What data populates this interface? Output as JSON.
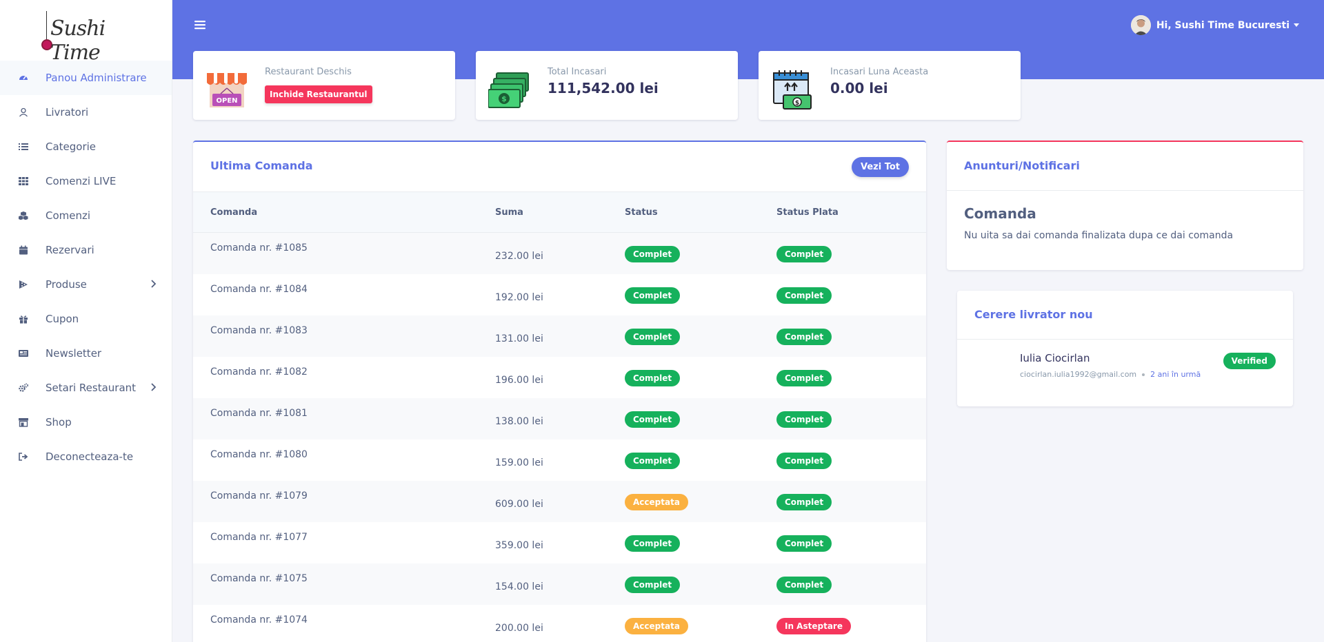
{
  "brand": {
    "logo_text": "Sushi Time"
  },
  "sidebar": {
    "items": [
      {
        "label": "Panou Administrare",
        "icon": "dashboard-icon",
        "active": true
      },
      {
        "label": "Livratori",
        "icon": "user-icon"
      },
      {
        "label": "Categorie",
        "icon": "list-icon"
      },
      {
        "label": "Comenzi LIVE",
        "icon": "grid-icon"
      },
      {
        "label": "Comenzi",
        "icon": "cubes-icon"
      },
      {
        "label": "Rezervari",
        "icon": "calendar-icon"
      },
      {
        "label": "Produse",
        "icon": "pizza-icon",
        "has_children": true
      },
      {
        "label": "Cupon",
        "icon": "gift-icon"
      },
      {
        "label": "Newsletter",
        "icon": "newspaper-icon"
      },
      {
        "label": "Setari Restaurant",
        "icon": "cogs-icon",
        "has_children": true
      },
      {
        "label": "Shop",
        "icon": "store-icon"
      },
      {
        "label": "Deconecteaza-te",
        "icon": "sign-out-icon"
      }
    ]
  },
  "header": {
    "user_greeting": "Hi, Sushi Time Bucuresti"
  },
  "stats": {
    "restaurant": {
      "label": "Restaurant Deschis",
      "button": "Inchide Restaurantul",
      "sign_text": "OPEN"
    },
    "total": {
      "label": "Total Incasari",
      "value": "111,542.00 lei"
    },
    "month": {
      "label": "Incasari Luna Aceasta",
      "value": "0.00 lei"
    }
  },
  "orders": {
    "title": "Ultima Comanda",
    "view_all": "Vezi Tot",
    "columns": [
      "Comanda",
      "Suma",
      "Status",
      "Status Plata"
    ],
    "rows": [
      {
        "order": "Comanda nr. #1085",
        "sum": "232.00 lei",
        "status": "Complet",
        "payment": "Complet"
      },
      {
        "order": "Comanda nr. #1084",
        "sum": "192.00 lei",
        "status": "Complet",
        "payment": "Complet"
      },
      {
        "order": "Comanda nr. #1083",
        "sum": "131.00 lei",
        "status": "Complet",
        "payment": "Complet"
      },
      {
        "order": "Comanda nr. #1082",
        "sum": "196.00 lei",
        "status": "Complet",
        "payment": "Complet"
      },
      {
        "order": "Comanda nr. #1081",
        "sum": "138.00 lei",
        "status": "Complet",
        "payment": "Complet"
      },
      {
        "order": "Comanda nr. #1080",
        "sum": "159.00 lei",
        "status": "Complet",
        "payment": "Complet"
      },
      {
        "order": "Comanda nr. #1079",
        "sum": "609.00 lei",
        "status": "Acceptata",
        "payment": "Complet"
      },
      {
        "order": "Comanda nr. #1077",
        "sum": "359.00 lei",
        "status": "Complet",
        "payment": "Complet"
      },
      {
        "order": "Comanda nr. #1075",
        "sum": "154.00 lei",
        "status": "Complet",
        "payment": "Complet"
      },
      {
        "order": "Comanda nr. #1074",
        "sum": "200.00 lei",
        "status": "Acceptata",
        "payment": "In Asteptare"
      }
    ]
  },
  "notifications": {
    "title": "Anunturi/Notificari",
    "heading": "Comanda",
    "text": "Nu uita sa dai comanda finalizata dupa ce dai comanda"
  },
  "courier_request": {
    "title": "Cerere livrator nou",
    "name": "Iulia Ciocirlan",
    "email": "ciocirlan.iulia1992@gmail.com",
    "time_ago": "2 ani în urmă",
    "badge": "Verified"
  },
  "colors": {
    "primary": "#5e72e4",
    "success": "#16b15c",
    "warning": "#fbb140",
    "danger": "#f5365c"
  }
}
